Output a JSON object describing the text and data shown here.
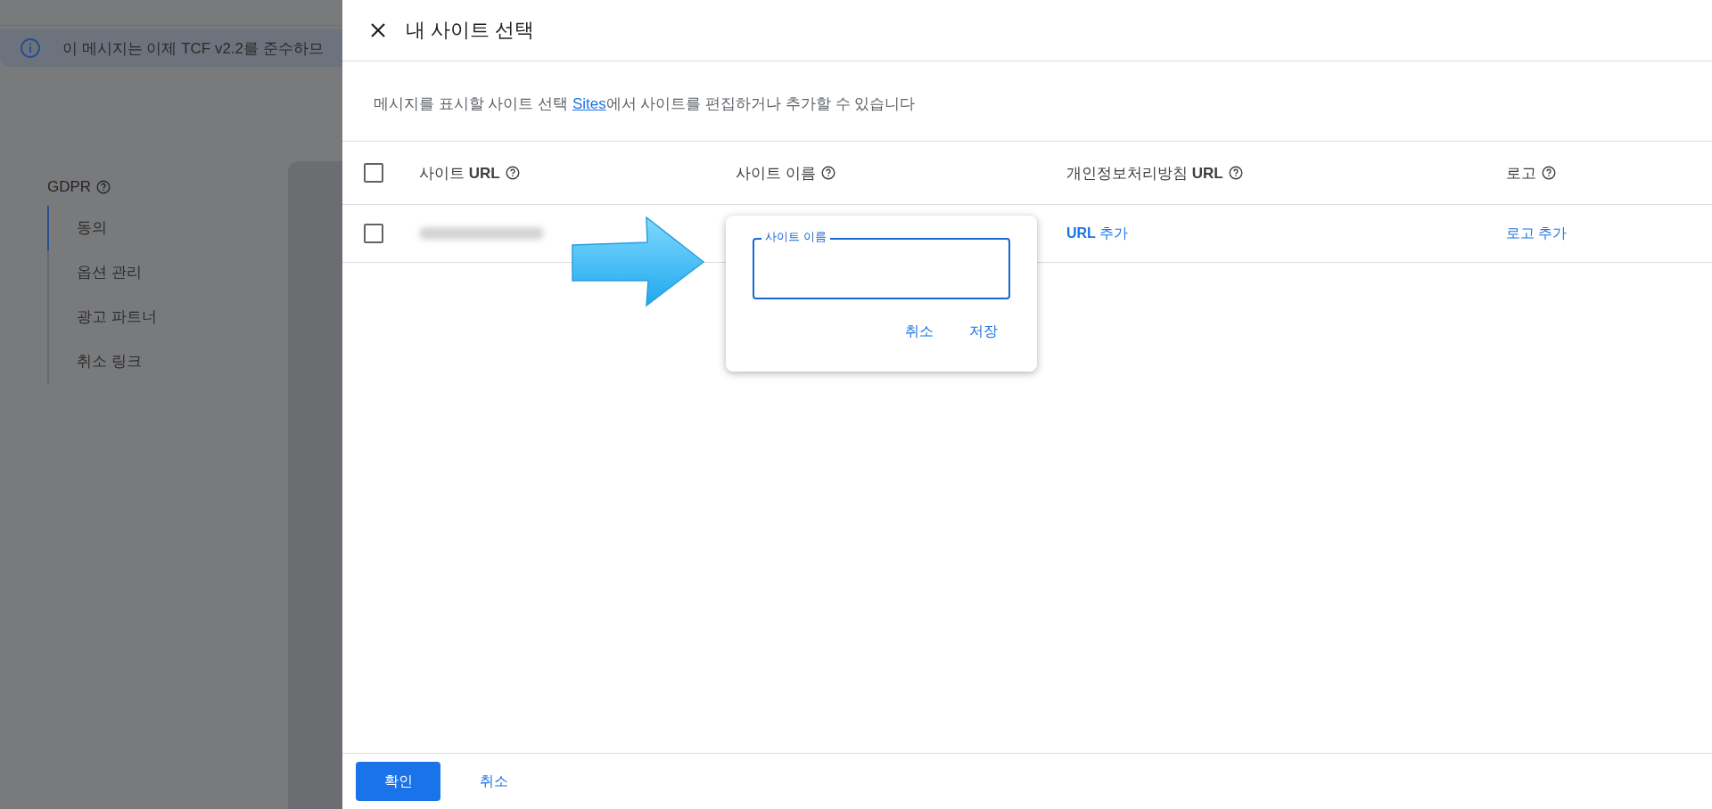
{
  "background": {
    "banner": {
      "text": "이 메시지는 이제 TCF v2.2를 준수하므"
    },
    "section": {
      "title": "GDPR",
      "items": [
        {
          "label": "동의",
          "selected": true
        },
        {
          "label": "옵션 관리",
          "selected": false
        },
        {
          "label": "광고 파트너",
          "selected": false
        },
        {
          "label": "취소 링크",
          "selected": false
        }
      ]
    }
  },
  "dialog": {
    "title": "내 사이트 선택",
    "description": {
      "before": "메시지를 표시할 사이트 선택 ",
      "link": "Sites",
      "after": "에서 사이트를 편집하거나 추가할 수 있습니다"
    },
    "table": {
      "select_all": {
        "checked": false
      },
      "columns": [
        {
          "label": "사이트 **URL**"
        },
        {
          "label": "사이트 이름"
        },
        {
          "label": "개인정보처리방침 **URL**"
        },
        {
          "label": "로고"
        }
      ],
      "rows": [
        {
          "checked": false,
          "url_blurred": true,
          "privacy_url": "**URL** 추가",
          "logo": "로고 추가"
        }
      ]
    },
    "popup": {
      "field": {
        "label": "사이트 이름"
      },
      "buttons": [
        "취소",
        "저장"
      ]
    },
    "footer": {
      "buttons": [
        {
          "label": "확인",
          "kind": "primary"
        },
        {
          "label": "취소",
          "kind": "text"
        }
      ]
    }
  }
}
